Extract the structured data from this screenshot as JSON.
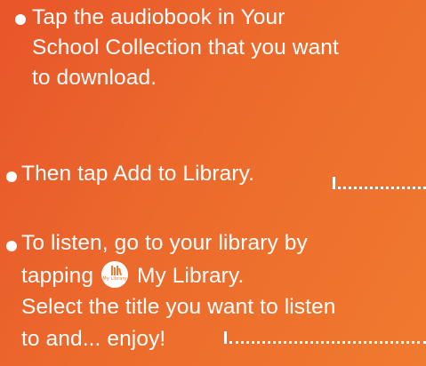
{
  "instructions": {
    "step1": {
      "lines": [
        "Tap the audiobook in Your",
        "School Collection that you want",
        "to download."
      ]
    },
    "step2": {
      "text": "Then tap Add to Library."
    },
    "step3": {
      "line1": "To listen, go to your library by",
      "line2_before": "tapping",
      "line2_after": "My Library.",
      "line3": "Select the title you want to listen",
      "line4": "to and... enjoy!"
    },
    "library_icon": {
      "name": "my-library-icon",
      "caption": "My Library"
    }
  },
  "colors": {
    "background_start": "#e8552a",
    "background_end": "#f07a2f",
    "text": "#ffffff"
  }
}
